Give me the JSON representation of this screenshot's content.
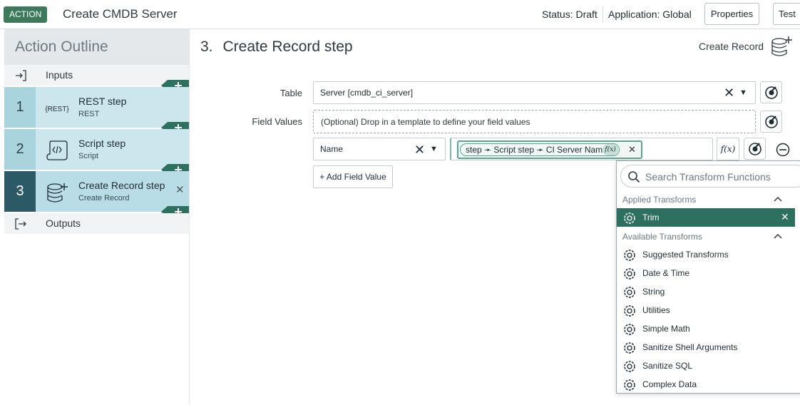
{
  "header": {
    "badge": "ACTION",
    "title": "Create CMDB Server",
    "status": "Status: Draft",
    "application": "Application: Global",
    "properties_label": "Properties",
    "test_label": "Test"
  },
  "sidebar": {
    "title": "Action Outline",
    "inputs_label": "Inputs",
    "outputs_label": "Outputs",
    "steps": [
      {
        "number": "1",
        "name": "REST step",
        "type": "REST",
        "icon": "rest-icon"
      },
      {
        "number": "2",
        "name": "Script step",
        "type": "Script",
        "icon": "script-icon"
      },
      {
        "number": "3",
        "name": "Create Record step",
        "type": "Create Record",
        "icon": "database-add-icon"
      }
    ],
    "add_step_symbol": "+"
  },
  "main": {
    "step_number": "3.",
    "step_title": "Create Record step",
    "step_type_label": "Create Record",
    "table_label": "Table",
    "table_value": "Server [cmdb_ci_server]",
    "field_values_label": "Field Values",
    "dropzone_text": "(Optional) Drop in a template to define your field values",
    "field_name": "Name",
    "pill_text": "step ➛ Script step ➛ CI Server Name",
    "fx_label": "f(x)",
    "add_field_label": "+ Add Field Value"
  },
  "transforms": {
    "search_placeholder": "Search Transform Functions",
    "applied_label": "Applied Transforms",
    "applied": [
      "Trim"
    ],
    "available_label": "Available Transforms",
    "available": [
      "Suggested Transforms",
      "Date & Time",
      "String",
      "Utilities",
      "Simple Math",
      "Sanitize Shell Arguments",
      "Sanitize SQL",
      "Complex Data"
    ]
  },
  "colors": {
    "accent_green": "#3d7a5c",
    "applied_row": "#2e7060",
    "active_step": "#2b5965",
    "step_bg": "#cbe6ec"
  }
}
